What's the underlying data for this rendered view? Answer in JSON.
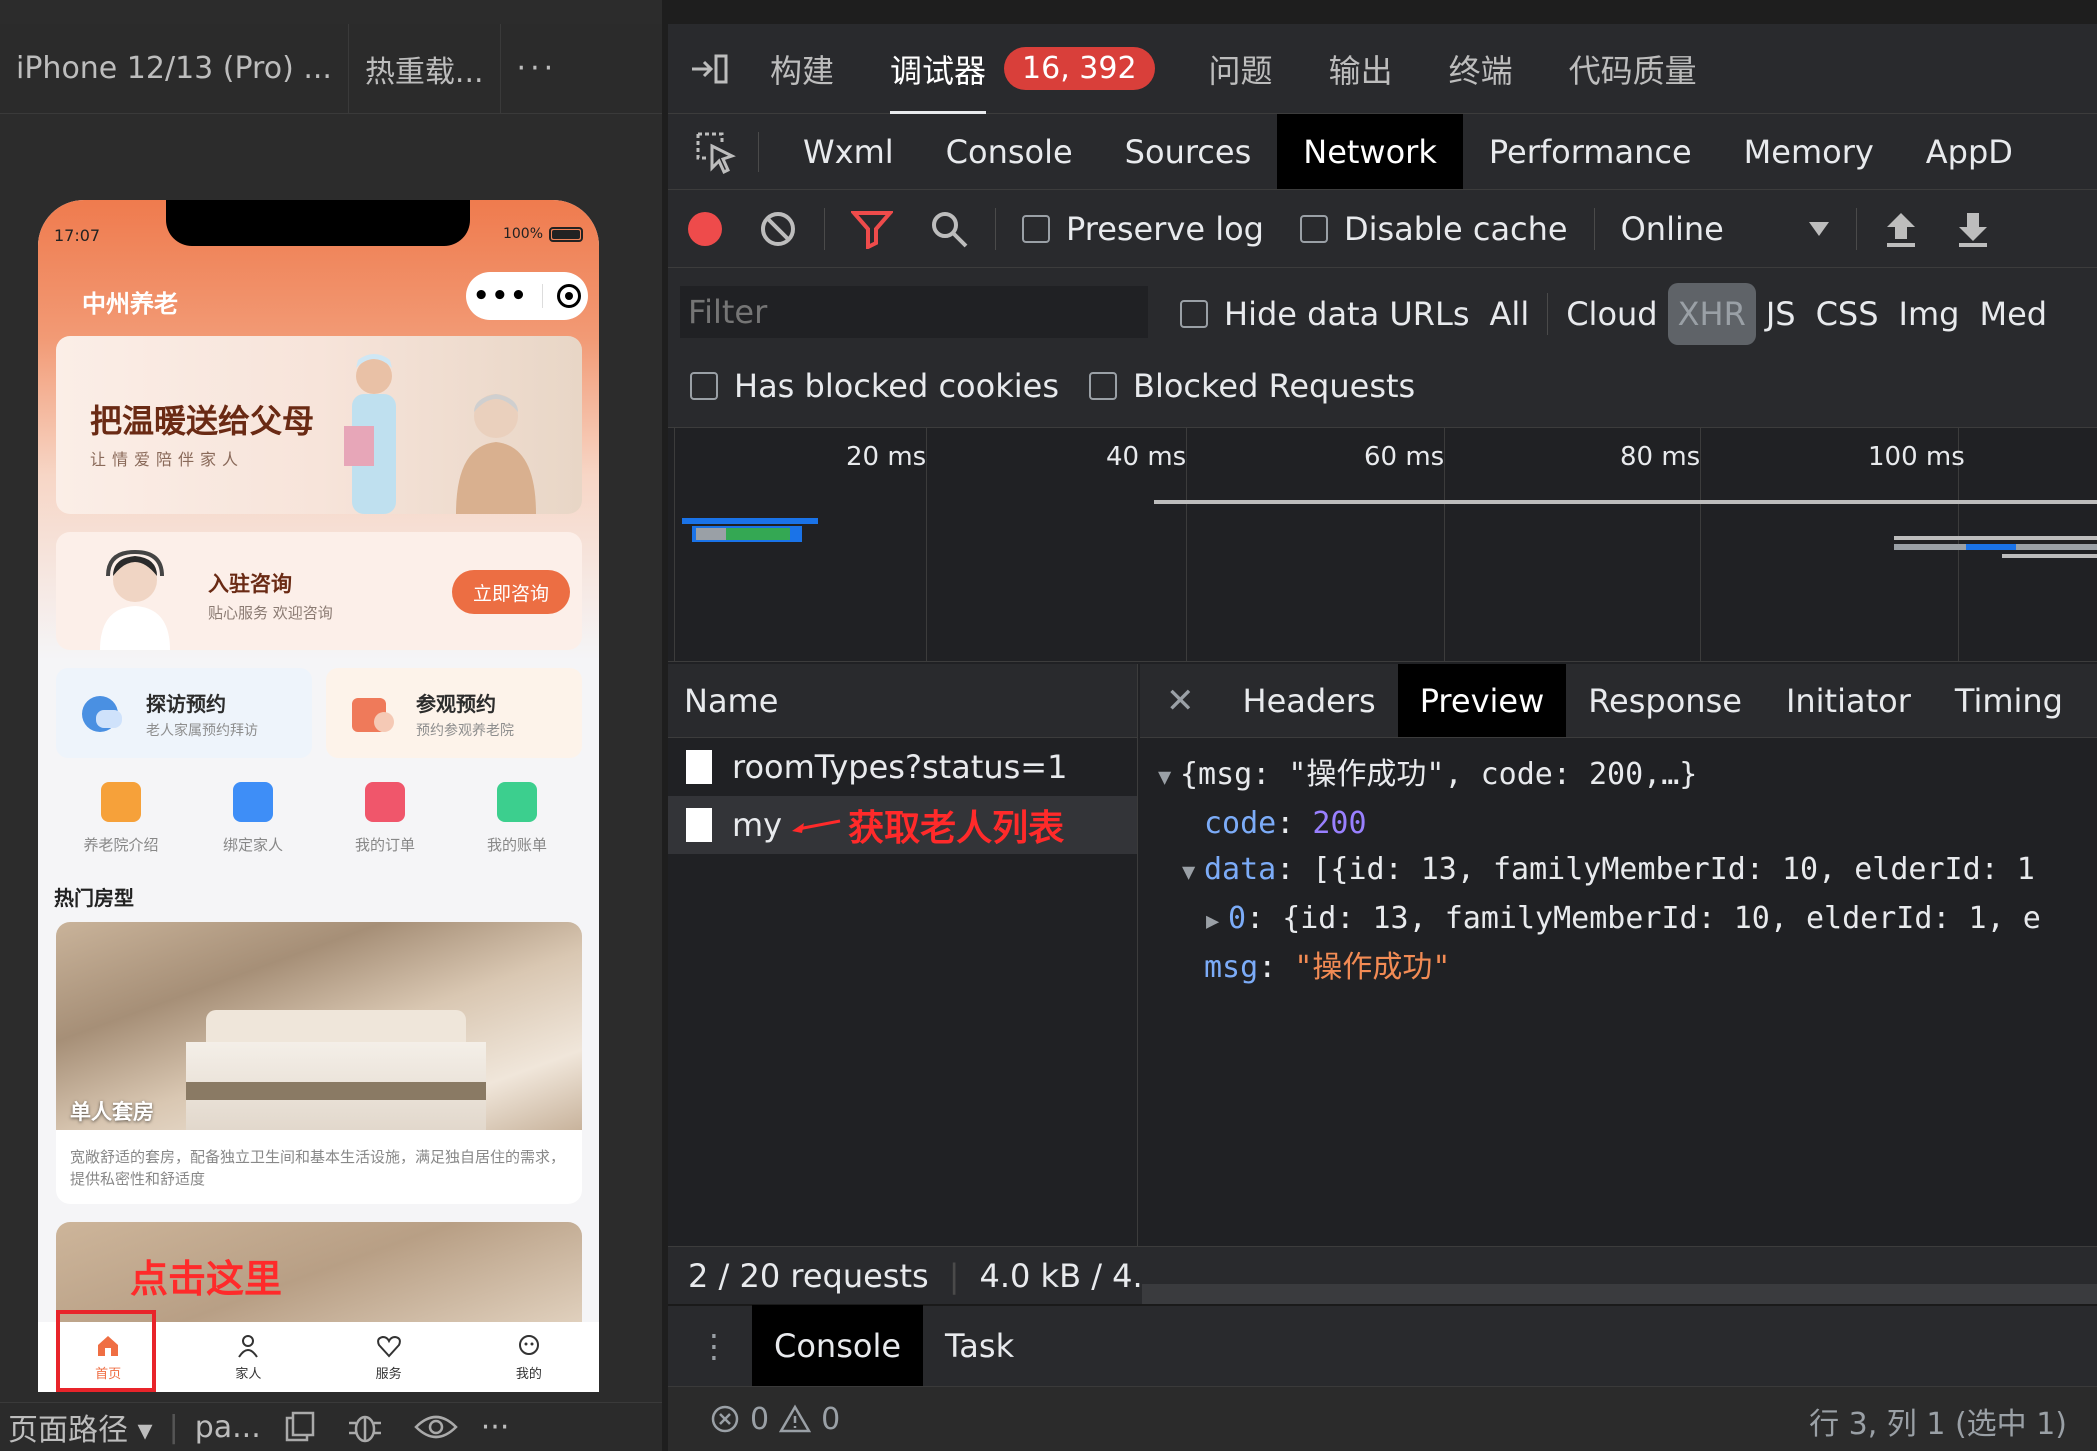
{
  "simulator": {
    "tabs": [
      "iPhone 12/13 (Pro) ...",
      "热重载...",
      "···"
    ],
    "bottom": {
      "path_label": "页面路径 ▾",
      "path_value": "pa...",
      "more": "···"
    }
  },
  "phone": {
    "status_time": "17:07",
    "battery": "100%",
    "app_title": "中州养老",
    "banner": {
      "title": "把温暖送给父母",
      "subtitle": "让情爱陪伴家人"
    },
    "consult": {
      "title": "入驻咨询",
      "subtitle": "贴心服务 欢迎咨询",
      "button": "立即咨询"
    },
    "cards": [
      {
        "title": "探访预约",
        "subtitle": "老人家属预约拜访"
      },
      {
        "title": "参观预约",
        "subtitle": "预约参观养老院"
      }
    ],
    "grid": [
      {
        "label": "养老院介绍",
        "color": "#f6a13a"
      },
      {
        "label": "绑定家人",
        "color": "#3e8ef7"
      },
      {
        "label": "我的订单",
        "color": "#f0566b"
      },
      {
        "label": "我的账单",
        "color": "#3ccf8e"
      }
    ],
    "section_title": "热门房型",
    "room": {
      "name": "单人套房",
      "description": "宽敞舒适的套房，配备独立卫生间和基本生活设施，满足独自居住的需求，提供私密性和舒适度"
    },
    "annotation_click": "点击这里",
    "tabbar": [
      {
        "label": "首页",
        "active": true
      },
      {
        "label": "家人",
        "active": false
      },
      {
        "label": "服务",
        "active": false
      },
      {
        "label": "我的",
        "active": false
      }
    ],
    "accent": "#ec6e43"
  },
  "devtools": {
    "top_tabs": [
      "构建",
      "调试器",
      "问题",
      "输出",
      "终端",
      "代码质量"
    ],
    "badge": "16, 392",
    "panel_tabs": [
      "Wxml",
      "Console",
      "Sources",
      "Network",
      "Performance",
      "Memory",
      "AppD"
    ],
    "active_panel": "Network",
    "toolbar": {
      "preserve_log": "Preserve log",
      "disable_cache": "Disable cache",
      "throttle": "Online"
    },
    "filter": {
      "placeholder": "Filter",
      "hide_data_urls": "Hide data URLs",
      "types": [
        "All",
        "Cloud",
        "XHR",
        "JS",
        "CSS",
        "Img",
        "Med"
      ],
      "active_type": "XHR",
      "has_blocked_cookies": "Has blocked cookies",
      "blocked_requests": "Blocked Requests"
    },
    "timeline_labels": [
      "20 ms",
      "40 ms",
      "60 ms",
      "80 ms",
      "100 ms"
    ],
    "requests": {
      "header": "Name",
      "rows": [
        {
          "name": "roomTypes?status=1"
        },
        {
          "name": "my",
          "annotation": "获取老人列表"
        }
      ]
    },
    "detail_tabs": [
      "Headers",
      "Preview",
      "Response",
      "Initiator",
      "Timing"
    ],
    "active_detail": "Preview",
    "preview": {
      "line1": "{msg: \"操作成功\", code: 200,…}",
      "code_key": "code",
      "code_val": "200",
      "data_key": "data",
      "data_val": "[{id: 13, familyMemberId: 10, elderId: 1",
      "item_key": "0",
      "item_val": "{id: 13, familyMemberId: 10, elderId: 1, e",
      "msg_key": "msg",
      "msg_val": "\"操作成功\""
    },
    "summary": {
      "requests": "2 / 20 requests",
      "size": "4.0 kB / 4."
    },
    "drawer_tabs": [
      "Console",
      "Task"
    ],
    "status": {
      "errors": "0",
      "warnings": "0",
      "position": "行 3, 列 1 (选中 1)"
    }
  }
}
